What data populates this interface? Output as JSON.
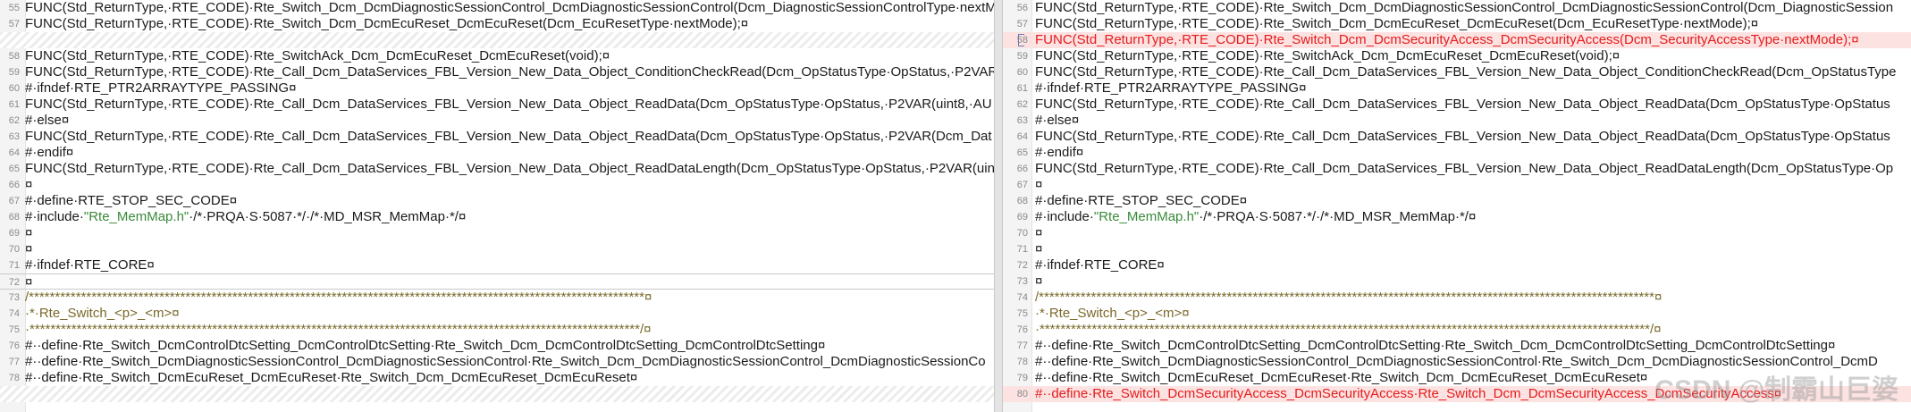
{
  "left_pane": {
    "rows": [
      {
        "ln": "55",
        "text": "FUNC(Std_ReturnType,·RTE_CODE)·Rte_Switch_Dcm_DcmDiagnosticSessionControl_DcmDiagnosticSessionControl(Dcm_DiagnosticSessionControlType·nextM",
        "kind": "code"
      },
      {
        "ln": "57",
        "text": "FUNC(Std_ReturnType,·RTE_CODE)·Rte_Switch_Dcm_DcmEcuReset_DcmEcuReset(Dcm_EcuResetType·nextMode);¤",
        "kind": "code"
      },
      {
        "ln": "",
        "text": "",
        "kind": "hatch"
      },
      {
        "ln": "58",
        "text": "FUNC(Std_ReturnType,·RTE_CODE)·Rte_SwitchAck_Dcm_DcmEcuReset_DcmEcuReset(void);¤",
        "kind": "code"
      },
      {
        "ln": "59",
        "text": "FUNC(Std_ReturnType,·RTE_CODE)·Rte_Call_Dcm_DataServices_FBL_Version_New_Data_Object_ConditionCheckRead(Dcm_OpStatusType·OpStatus,·P2VAR",
        "kind": "code"
      },
      {
        "ln": "60",
        "text": "#·ifndef·RTE_PTR2ARRAYTYPE_PASSING¤",
        "kind": "code"
      },
      {
        "ln": "61",
        "text": "FUNC(Std_ReturnType,·RTE_CODE)·Rte_Call_Dcm_DataServices_FBL_Version_New_Data_Object_ReadData(Dcm_OpStatusType·OpStatus,·P2VAR(uint8,·AU",
        "kind": "code"
      },
      {
        "ln": "62",
        "text": "#·else¤",
        "kind": "code"
      },
      {
        "ln": "63",
        "text": "FUNC(Std_ReturnType,·RTE_CODE)·Rte_Call_Dcm_DataServices_FBL_Version_New_Data_Object_ReadData(Dcm_OpStatusType·OpStatus,·P2VAR(Dcm_Dat",
        "kind": "code"
      },
      {
        "ln": "64",
        "text": "#·endif¤",
        "kind": "code"
      },
      {
        "ln": "65",
        "text": "FUNC(Std_ReturnType,·RTE_CODE)·Rte_Call_Dcm_DataServices_FBL_Version_New_Data_Object_ReadDataLength(Dcm_OpStatusType·OpStatus,·P2VAR(uin",
        "kind": "code"
      },
      {
        "ln": "66",
        "text": "¤",
        "kind": "code"
      },
      {
        "ln": "67",
        "text": "#·define·RTE_STOP_SEC_CODE¤",
        "kind": "code"
      },
      {
        "ln": "68",
        "text": "#·include·\"Rte_MemMap.h\"·/*·PRQA·S·5087·*/·/*·MD_MSR_MemMap·*/¤",
        "kind": "code"
      },
      {
        "ln": "69",
        "text": "¤",
        "kind": "code"
      },
      {
        "ln": "70",
        "text": "¤",
        "kind": "code"
      },
      {
        "ln": "71",
        "text": "#·ifndef·RTE_CORE¤",
        "kind": "code"
      },
      {
        "ln": "72",
        "text": "¤",
        "kind": "cursor"
      },
      {
        "ln": "73",
        "text": "/**********************************************************************************************************************¤",
        "kind": "code"
      },
      {
        "ln": "74",
        "text": "·*·Rte_Switch_<p>_<m>¤",
        "kind": "code"
      },
      {
        "ln": "75",
        "text": "·*********************************************************************************************************************/¤",
        "kind": "code"
      },
      {
        "ln": "76",
        "text": "#··define·Rte_Switch_DcmControlDtcSetting_DcmControlDtcSetting·Rte_Switch_Dcm_DcmControlDtcSetting_DcmControlDtcSetting¤",
        "kind": "code"
      },
      {
        "ln": "77",
        "text": "#··define·Rte_Switch_DcmDiagnosticSessionControl_DcmDiagnosticSessionControl·Rte_Switch_Dcm_DcmDiagnosticSessionControl_DcmDiagnosticSessionCo",
        "kind": "code"
      },
      {
        "ln": "78",
        "text": "#··define·Rte_Switch_DcmEcuReset_DcmEcuReset·Rte_Switch_Dcm_DcmEcuReset_DcmEcuReset¤",
        "kind": "code"
      },
      {
        "ln": "",
        "text": "",
        "kind": "hatch"
      }
    ]
  },
  "right_pane": {
    "rows": [
      {
        "ln": "56",
        "text": "FUNC(Std_ReturnType,·RTE_CODE)·Rte_Switch_Dcm_DcmDiagnosticSessionControl_DcmDiagnosticSessionControl(Dcm_DiagnosticSession",
        "kind": "code"
      },
      {
        "ln": "57",
        "text": "FUNC(Std_ReturnType,·RTE_CODE)·Rte_Switch_Dcm_DcmEcuReset_DcmEcuReset(Dcm_EcuResetType·nextMode);¤",
        "kind": "code"
      },
      {
        "ln": "58",
        "text": "FUNC(Std_ReturnType,·RTE_CODE)·Rte_Switch_Dcm_DcmSecurityAccess_DcmSecurityAccess(Dcm_SecurityAccessType·nextMode);¤",
        "kind": "changed"
      },
      {
        "ln": "59",
        "text": "FUNC(Std_ReturnType,·RTE_CODE)·Rte_SwitchAck_Dcm_DcmEcuReset_DcmEcuReset(void);¤",
        "kind": "code"
      },
      {
        "ln": "60",
        "text": "FUNC(Std_ReturnType,·RTE_CODE)·Rte_Call_Dcm_DataServices_FBL_Version_New_Data_Object_ConditionCheckRead(Dcm_OpStatusType",
        "kind": "code"
      },
      {
        "ln": "61",
        "text": "#·ifndef·RTE_PTR2ARRAYTYPE_PASSING¤",
        "kind": "code"
      },
      {
        "ln": "62",
        "text": "FUNC(Std_ReturnType,·RTE_CODE)·Rte_Call_Dcm_DataServices_FBL_Version_New_Data_Object_ReadData(Dcm_OpStatusType·OpStatus",
        "kind": "code"
      },
      {
        "ln": "63",
        "text": "#·else¤",
        "kind": "code"
      },
      {
        "ln": "64",
        "text": "FUNC(Std_ReturnType,·RTE_CODE)·Rte_Call_Dcm_DataServices_FBL_Version_New_Data_Object_ReadData(Dcm_OpStatusType·OpStatus",
        "kind": "code"
      },
      {
        "ln": "65",
        "text": "#·endif¤",
        "kind": "code"
      },
      {
        "ln": "66",
        "text": "FUNC(Std_ReturnType,·RTE_CODE)·Rte_Call_Dcm_DataServices_FBL_Version_New_Data_Object_ReadDataLength(Dcm_OpStatusType·Op",
        "kind": "code"
      },
      {
        "ln": "67",
        "text": "¤",
        "kind": "code"
      },
      {
        "ln": "68",
        "text": "#·define·RTE_STOP_SEC_CODE¤",
        "kind": "code"
      },
      {
        "ln": "69",
        "text": "#·include·\"Rte_MemMap.h\"·/*·PRQA·S·5087·*/·/*·MD_MSR_MemMap·*/¤",
        "kind": "code"
      },
      {
        "ln": "70",
        "text": "¤",
        "kind": "code"
      },
      {
        "ln": "71",
        "text": "¤",
        "kind": "code"
      },
      {
        "ln": "72",
        "text": "#·ifndef·RTE_CORE¤",
        "kind": "code"
      },
      {
        "ln": "73",
        "text": "¤",
        "kind": "code"
      },
      {
        "ln": "74",
        "text": "/**********************************************************************************************************************¤",
        "kind": "code"
      },
      {
        "ln": "75",
        "text": "·*·Rte_Switch_<p>_<m>¤",
        "kind": "code"
      },
      {
        "ln": "76",
        "text": "·*********************************************************************************************************************/¤",
        "kind": "code"
      },
      {
        "ln": "77",
        "text": "#··define·Rte_Switch_DcmControlDtcSetting_DcmControlDtcSetting·Rte_Switch_Dcm_DcmControlDtcSetting_DcmControlDtcSetting¤",
        "kind": "code"
      },
      {
        "ln": "78",
        "text": "#··define·Rte_Switch_DcmDiagnosticSessionControl_DcmDiagnosticSessionControl·Rte_Switch_Dcm_DcmDiagnosticSessionControl_DcmD",
        "kind": "code"
      },
      {
        "ln": "79",
        "text": "#··define·Rte_Switch_DcmEcuReset_DcmEcuReset·Rte_Switch_Dcm_DcmEcuReset_DcmEcuReset¤",
        "kind": "code"
      },
      {
        "ln": "80",
        "text": "#··define·Rte_Switch_DcmSecurityAccess_DcmSecurityAccess·Rte_Switch_Dcm_DcmSecurityAccess_DcmSecurityAccess¤",
        "kind": "changed"
      }
    ]
  },
  "watermark": "CSDN @制霸山巨婆",
  "colors": {
    "changed_text": "#e51b1b",
    "changed_bg": "#fde2e2",
    "string_literal": "#3a8a3a",
    "comment_text": "#7a6a2a",
    "line_number": "#8a8a8a"
  }
}
